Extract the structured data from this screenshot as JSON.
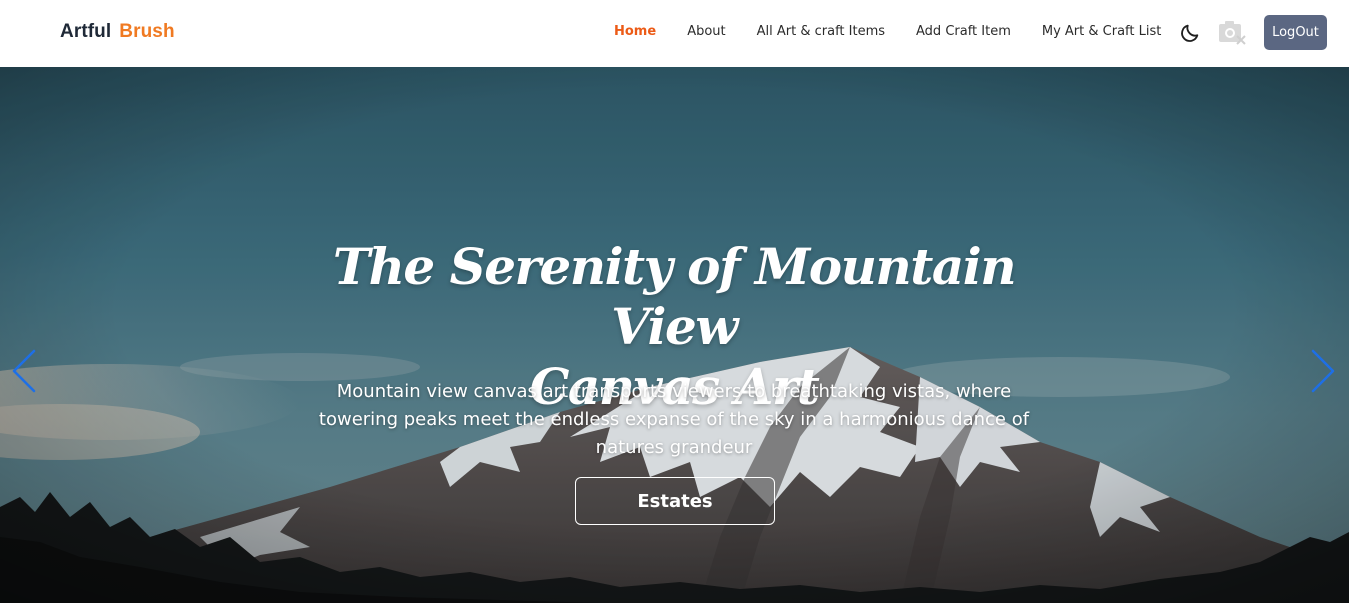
{
  "brand": {
    "word1": "Artful",
    "word2": "Brush"
  },
  "nav": {
    "items": [
      {
        "label": "Home",
        "active": true
      },
      {
        "label": "About"
      },
      {
        "label": "All Art & craft Items"
      },
      {
        "label": "Add Craft Item"
      },
      {
        "label": "My Art & Craft List"
      }
    ],
    "theme_icon": "moon-icon",
    "avatar_icon": "broken-image-icon",
    "logout_label": "LogOut"
  },
  "hero": {
    "title_line1": "The Serenity of Mountain View",
    "title_line2": "Canvas Art",
    "description": "Mountain view canvas art transports viewers to breathtaking vistas, where towering peaks meet the endless expanse of the sky in a harmonious dance of natures grandeur",
    "button_label": "Estates",
    "prev_icon": "chevron-left-icon",
    "next_icon": "chevron-right-icon"
  },
  "colors": {
    "accent": "#ec5b17",
    "brand_accent": "#f07a22",
    "logout_bg": "#5b6782",
    "carousel_arrow": "#1e6fe6"
  }
}
